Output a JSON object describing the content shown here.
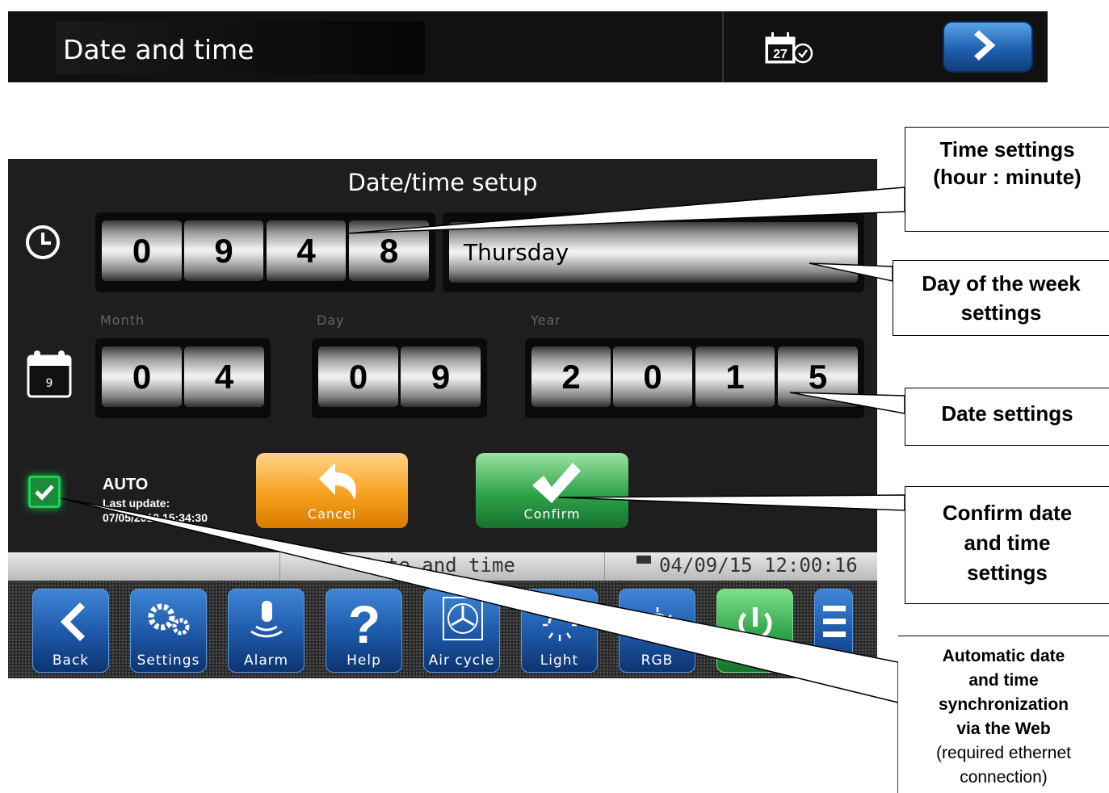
{
  "header": {
    "title": "Date and time",
    "calendar_icon_day": "27"
  },
  "panel": {
    "title": "Date/time setup",
    "time": {
      "digits": [
        "0",
        "9",
        "4",
        "8"
      ]
    },
    "weekday": "Thursday",
    "date_labels": {
      "month": "Month",
      "day": "Day",
      "year": "Year"
    },
    "date": {
      "month": [
        "0",
        "4"
      ],
      "day": [
        "0",
        "9"
      ],
      "year": [
        "2",
        "0",
        "1",
        "5"
      ]
    },
    "calendar_icon_day": "9",
    "auto": {
      "label": "AUTO",
      "last_update_label": "Last update:",
      "last_update_value": "07/05/2018 15:34:30"
    },
    "cancel_label": "Cancel",
    "confirm_label": "Confirm"
  },
  "status_bar": {
    "center": "Date and time",
    "datetime": "04/09/15 12:00:16"
  },
  "nav": [
    {
      "label": "Back",
      "icon": "chevron-left-icon"
    },
    {
      "label": "Settings",
      "icon": "gears-icon"
    },
    {
      "label": "Alarm",
      "icon": "bell-icon"
    },
    {
      "label": "Help",
      "icon": "question-icon"
    },
    {
      "label": "Air cycle",
      "icon": "fan-icon"
    },
    {
      "label": "Light",
      "icon": "sun-icon"
    },
    {
      "label": "RGB",
      "icon": "rgb-icon"
    },
    {
      "label": "",
      "icon": "power-icon"
    },
    {
      "label": "",
      "icon": "menu-icon"
    }
  ],
  "callouts": {
    "time": [
      "Time settings",
      "(hour : minute)"
    ],
    "weekday": [
      "Day of the week",
      "settings"
    ],
    "date": [
      "Date settings"
    ],
    "confirm": [
      "Confirm date",
      "and time",
      "settings"
    ],
    "auto": [
      "Automatic date",
      "and time",
      "synchronization",
      "via the Web"
    ],
    "auto_note": [
      "(required ethernet",
      "connection)"
    ]
  },
  "colors": {
    "confirm": "#2fa34a",
    "cancel": "#f6a11e",
    "nav_blue": "#1d57a6",
    "checkbox": "#1c8a3c"
  }
}
